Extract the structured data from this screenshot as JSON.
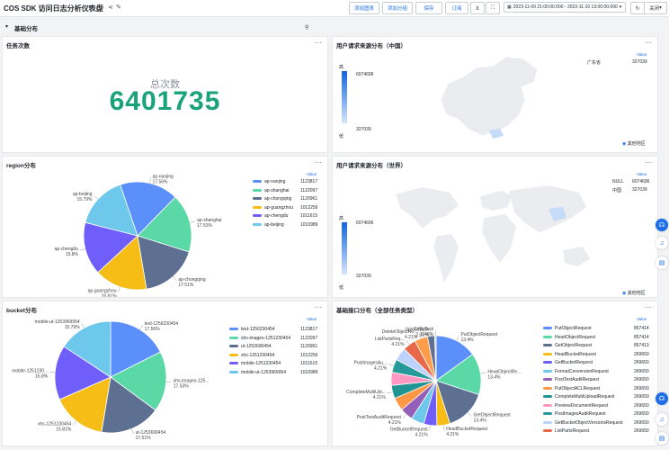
{
  "header": {
    "title": "COS SDK 访问日志分析仪表盘",
    "buttons": {
      "add_chart": "添加图表",
      "add_group": "添加分组",
      "save": "保存",
      "subscribe": "订阅"
    },
    "date_range": "2023-11-09 21:00:00.000 - 2023-11-10 13:00:00.000",
    "refresh": "关闭"
  },
  "section": {
    "title": "基础分布"
  },
  "task_count": {
    "title": "任务次数",
    "label": "总次数",
    "value": "6401735"
  },
  "map_china": {
    "title": "用户请求来源分布（中国）",
    "scale_high": "高",
    "scale_low": "低",
    "scale_max": "6074696",
    "scale_min": "327039",
    "value_header": "Value",
    "rows": [
      {
        "name": "广东省",
        "value": "327039"
      }
    ],
    "other": "其他地区"
  },
  "map_world": {
    "title": "用户请求来源分布（世界）",
    "scale_high": "高",
    "scale_low": "低",
    "scale_max": "6074696",
    "scale_min": "327039",
    "value_header": "Value",
    "rows": [
      {
        "name": "NULL",
        "value": "6074696"
      },
      {
        "name": "中国",
        "value": "327039"
      }
    ],
    "other": "其他地区"
  },
  "region": {
    "title": "region分布",
    "value_header": "Value",
    "legend": [
      {
        "name": "ap-nanjing",
        "value": "1123817",
        "color": "#5b8ff9"
      },
      {
        "name": "ap-shanghai",
        "value": "1122097",
        "color": "#5ad8a6"
      },
      {
        "name": "ap-chongqing",
        "value": "1120961",
        "color": "#5d7092"
      },
      {
        "name": "ap-guangzhou",
        "value": "1012256",
        "color": "#f6bd16"
      },
      {
        "name": "ap-chengdu",
        "value": "1011615",
        "color": "#6f5ef9"
      },
      {
        "name": "ap-beijing",
        "value": "1010989",
        "color": "#6dc8ec"
      }
    ],
    "labels": [
      {
        "name": "ap-nanjing",
        "pct": "17.56%"
      },
      {
        "name": "ap-shanghai",
        "pct": "17.53%"
      },
      {
        "name": "ap-chongqing",
        "pct": "17.51%"
      },
      {
        "name": "ap-guangzhou",
        "pct": "15.81%"
      },
      {
        "name": "ap-chengdu",
        "pct": "15.8%"
      },
      {
        "name": "ap-beijing",
        "pct": "15.79%"
      }
    ]
  },
  "bucket": {
    "title": "bucket分布",
    "value_header": "Value",
    "legend": [
      {
        "name": "test-1256230454",
        "value": "1123817",
        "color": "#5b8ff9"
      },
      {
        "name": "xhs-images-1251230454",
        "value": "1122097",
        "color": "#5ad8a6"
      },
      {
        "name": "ut-1253690454",
        "value": "1120961",
        "color": "#5d7092"
      },
      {
        "name": "xhs-1251230454",
        "value": "1012256",
        "color": "#f6bd16"
      },
      {
        "name": "mobile-1251230454",
        "value": "1011615",
        "color": "#6f5ef9"
      },
      {
        "name": "mobile-ut-1253969954",
        "value": "1010989",
        "color": "#6dc8ec"
      }
    ],
    "labels": [
      {
        "name": "test-1256230454",
        "pct": "17.56%"
      },
      {
        "name": "xhs-images-125...",
        "pct": "17.53%"
      },
      {
        "name": "ut-1253690454",
        "pct": "17.51%"
      },
      {
        "name": "xhs-1251230454",
        "pct": "15.81%"
      },
      {
        "name": "mobile-1251230...",
        "pct": "15.8%"
      },
      {
        "name": "mobile-ut-1253969954",
        "pct": "15.79%"
      }
    ]
  },
  "api": {
    "title": "基础接口分布（全部任务类型）",
    "value_header": "Value",
    "legend": [
      {
        "name": "PutObjectRequest",
        "value": "857414",
        "color": "#5b8ff9"
      },
      {
        "name": "HeadObjectRequest",
        "value": "857414",
        "color": "#5ad8a6"
      },
      {
        "name": "GetObjectRequest",
        "value": "857413",
        "color": "#5d7092"
      },
      {
        "name": "HeadBucketRequest",
        "value": "269650",
        "color": "#f6bd16"
      },
      {
        "name": "GetBucketRequest",
        "value": "269650",
        "color": "#6f5ef9"
      },
      {
        "name": "FormatConversionRequest",
        "value": "269650",
        "color": "#6dc8ec"
      },
      {
        "name": "PostTextAuditRequest",
        "value": "269650",
        "color": "#945fb9"
      },
      {
        "name": "PutObjectACLRequest",
        "value": "269650",
        "color": "#ff9845"
      },
      {
        "name": "CompleteMultiUploadRequest",
        "value": "269650",
        "color": "#1e9493"
      },
      {
        "name": "PreviewDocumentRequest",
        "value": "269650",
        "color": "#ff99c3"
      },
      {
        "name": "PostImagesAuditRequest",
        "value": "269650",
        "color": "#269a99"
      },
      {
        "name": "GetBucketObjectVersionsRequest",
        "value": "269650",
        "color": "#bdd2fd"
      },
      {
        "name": "ListPartsRequest",
        "value": "269650",
        "color": "#e8684a"
      }
    ],
    "labels": [
      {
        "name": "PutObjectRequest",
        "pct": "13.4%"
      },
      {
        "name": "HeadObjectRe...",
        "pct": "13.4%"
      },
      {
        "name": "GetObjectRequest",
        "pct": "13.4%"
      },
      {
        "name": "HeadBucketRequest",
        "pct": "4.21%"
      },
      {
        "name": "GetBucketRequest",
        "pct": "4.21%"
      },
      {
        "name": "PostTextAuditRequest",
        "pct": "4.21%"
      },
      {
        "name": "CompleteMultiUpl...",
        "pct": "4.21%"
      },
      {
        "name": "PostImagesAu...",
        "pct": "4.21%"
      },
      {
        "name": "ListPartsReq...",
        "pct": "4.21%"
      },
      {
        "name": "DeleteObjectRe...",
        "pct": "4.21%"
      },
      {
        "name": "UploadTask",
        "pct": "2.31%"
      },
      {
        "name": "CopyTask",
        "pct": "0.46%"
      }
    ]
  },
  "chart_data": [
    {
      "type": "pie",
      "title": "region分布",
      "categories": [
        "ap-nanjing",
        "ap-shanghai",
        "ap-chongqing",
        "ap-guangzhou",
        "ap-chengdu",
        "ap-beijing"
      ],
      "values": [
        1123817,
        1122097,
        1120961,
        1012256,
        1011615,
        1010989
      ]
    },
    {
      "type": "pie",
      "title": "bucket分布",
      "categories": [
        "test-1256230454",
        "xhs-images-1251230454",
        "ut-1253690454",
        "xhs-1251230454",
        "mobile-1251230454",
        "mobile-ut-1253969954"
      ],
      "values": [
        1123817,
        1122097,
        1120961,
        1012256,
        1011615,
        1010989
      ]
    },
    {
      "type": "pie",
      "title": "基础接口分布（全部任务类型）",
      "categories": [
        "PutObjectRequest",
        "HeadObjectRequest",
        "GetObjectRequest",
        "HeadBucketRequest",
        "GetBucketRequest",
        "FormatConversionRequest",
        "PostTextAuditRequest",
        "PutObjectACLRequest",
        "CompleteMultiUploadRequest",
        "PreviewDocumentRequest",
        "PostImagesAuditRequest",
        "GetBucketObjectVersionsRequest",
        "ListPartsRequest",
        "DeleteObjectRequest",
        "UploadTask",
        "CopyTask"
      ],
      "values": [
        857414,
        857414,
        857413,
        269650,
        269650,
        269650,
        269650,
        269650,
        269650,
        269650,
        269650,
        269650,
        269650,
        269650,
        147900,
        29400
      ]
    }
  ]
}
